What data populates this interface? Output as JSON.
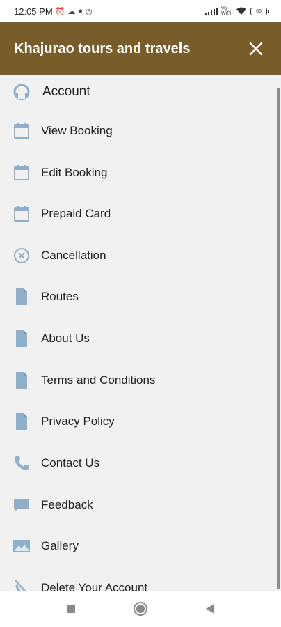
{
  "status_bar": {
    "time": "12:05 PM",
    "battery": "66",
    "network_label": "Vo WiFi"
  },
  "app_bar": {
    "title": "Khajurao tours and travels",
    "close_label": "✕"
  },
  "menu": {
    "items": [
      {
        "label": "Account",
        "icon": "account-icon"
      },
      {
        "label": "View Booking",
        "icon": "calendar-icon"
      },
      {
        "label": "Edit Booking",
        "icon": "calendar-icon"
      },
      {
        "label": "Prepaid Card",
        "icon": "calendar-icon"
      },
      {
        "label": "Cancellation",
        "icon": "cancel-icon"
      },
      {
        "label": "Routes",
        "icon": "document-icon"
      },
      {
        "label": "About Us",
        "icon": "document-icon"
      },
      {
        "label": "Terms and Conditions",
        "icon": "document-icon"
      },
      {
        "label": "Privacy Policy",
        "icon": "document-icon"
      },
      {
        "label": "Contact Us",
        "icon": "phone-icon"
      },
      {
        "label": "Feedback",
        "icon": "chat-icon"
      },
      {
        "label": "Gallery",
        "icon": "image-icon"
      },
      {
        "label": "Delete Your Account",
        "icon": "delete-account-icon"
      }
    ]
  },
  "colors": {
    "app_bar": "#785d2b",
    "drawer_bg": "#f1f1f1",
    "icon": "#8fb0c8"
  }
}
